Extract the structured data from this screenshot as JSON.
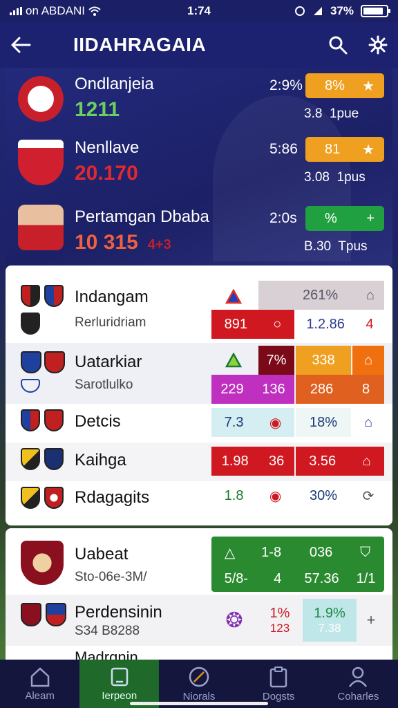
{
  "status": {
    "carrier": "on ABDANI",
    "time": "1:74",
    "battery": "37%"
  },
  "appbar": {
    "title": "IIDAHRAGAIA",
    "back_icon": "arrow-left-icon",
    "search_icon": "search-icon",
    "settings_icon": "gear-icon"
  },
  "hero": {
    "rows": [
      {
        "name": "Ondlanjeia",
        "score": "1211",
        "pct": "2:9%",
        "badge": "8%",
        "badge_color": "#f0a020",
        "sub": "3.8  1pue"
      },
      {
        "name": "Nenllave",
        "score": "20.170",
        "pct": "5:86",
        "badge": "81",
        "badge_color": "#f0a020",
        "sub": "3.08  1pus"
      },
      {
        "name": "Pertamgan Dbaba",
        "score": "10  315",
        "score_extra": "4+3",
        "pct": "2:0s",
        "badge": "%",
        "badge_color": "#20a040",
        "sub": "B.30  Tpus"
      }
    ]
  },
  "table1": {
    "rows": [
      {
        "name": "Indangam",
        "sub": "Rerluridriam",
        "c1": "",
        "c2": "261%",
        "c3": "891",
        "c4": "1.2.86",
        "c5": "4"
      },
      {
        "name": "Uatarkiar",
        "sub": "Sarotlulko",
        "c1": "7%",
        "c2": "338",
        "c3": "229",
        "c4": "136",
        "c5": "286",
        "c6": "8"
      },
      {
        "name": "Detcis",
        "c1": "7.3",
        "c2": "18%"
      },
      {
        "name": "Kaihga",
        "c1": "1.98",
        "c2": "36",
        "c3": "3.56"
      },
      {
        "name": "Rdagagits",
        "c1": "1.8",
        "c2": "30%"
      }
    ]
  },
  "table2": {
    "rows": [
      {
        "name": "Uabeat",
        "sub": "Sto-06e-3M/",
        "c1": "1-8",
        "c2": "036",
        "c3": "5/8-",
        "c4": "4",
        "c5": "57.36",
        "c6": "1/1"
      },
      {
        "name": "Perdensinin",
        "sub": "S34 B8288",
        "c1": "1%",
        "c2": "123",
        "c3": "1.9%",
        "c4": "7.38"
      },
      {
        "name": "Madrgnin"
      }
    ]
  },
  "nav": [
    {
      "label": "Aleam",
      "icon": "home-icon"
    },
    {
      "label": "Ierpeon",
      "icon": "tablet-icon"
    },
    {
      "label": "Niorals",
      "icon": "ball-icon"
    },
    {
      "label": "Dogsts",
      "icon": "clipboard-icon"
    },
    {
      "label": "Coharles",
      "icon": "person-icon"
    }
  ]
}
